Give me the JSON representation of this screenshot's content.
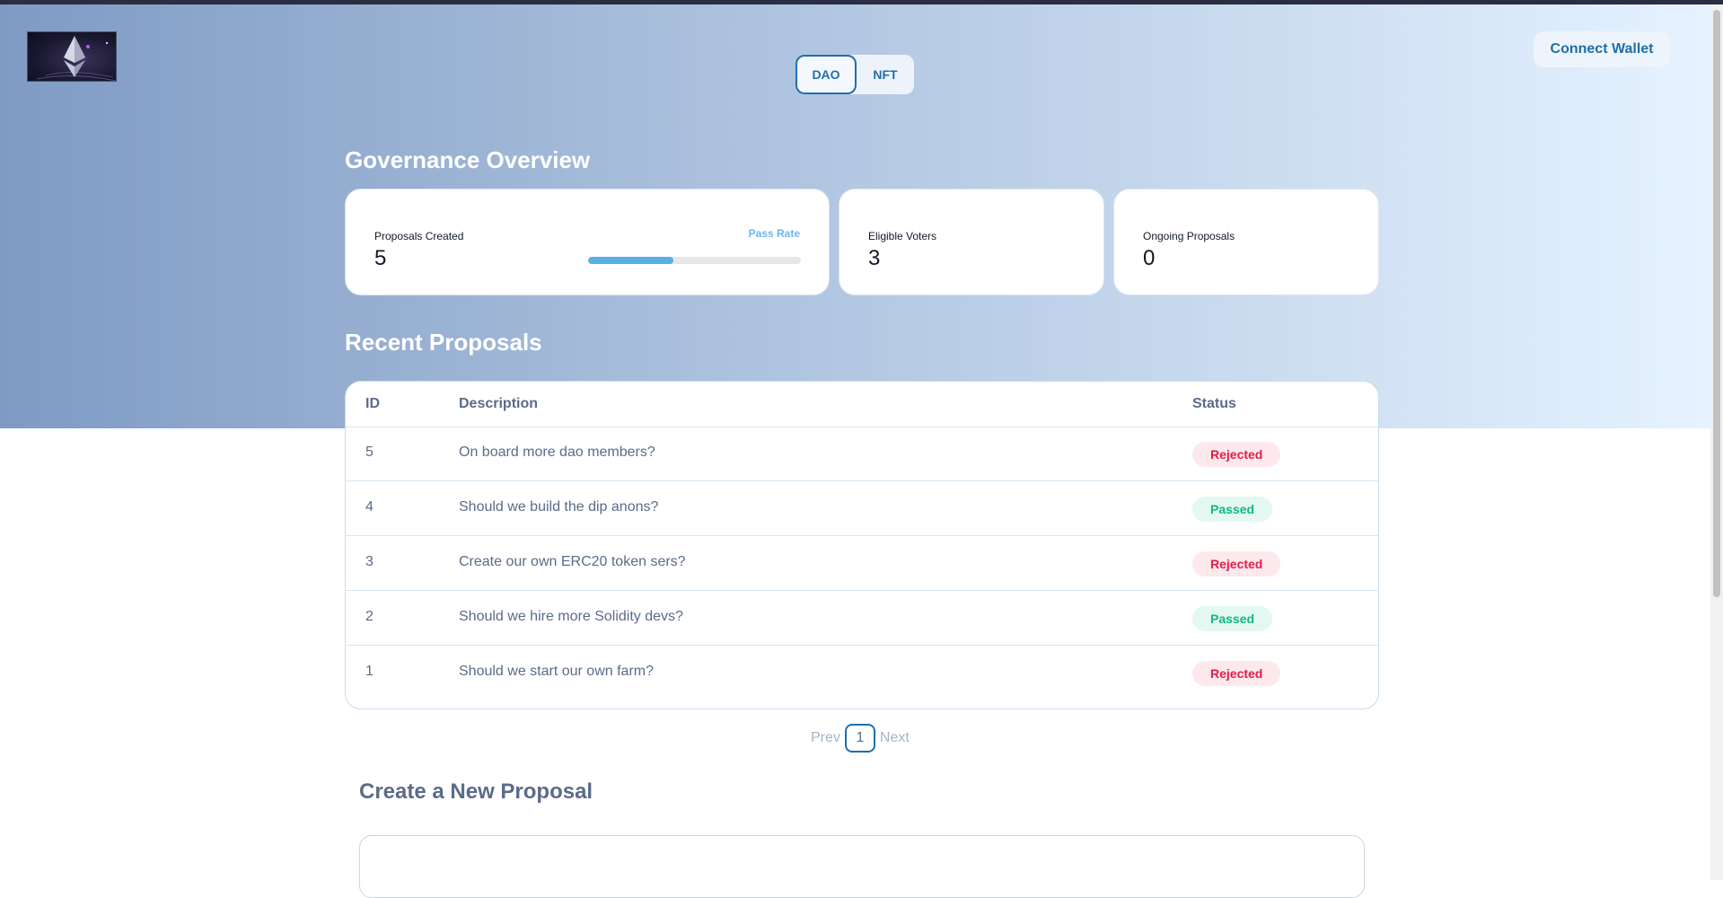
{
  "header": {
    "toggle": [
      {
        "label": "DAO",
        "active": true
      },
      {
        "label": "NFT",
        "active": false
      }
    ],
    "connect_label": "Connect Wallet",
    "logo": "ethereum-logo"
  },
  "overview": {
    "title": "Governance Overview",
    "proposals_created_label": "Proposals Created",
    "proposals_created_value": "5",
    "pass_rate_label": "Pass Rate",
    "pass_rate_fraction": 0.4,
    "eligible_voters_label": "Eligible Voters",
    "eligible_voters_value": "3",
    "ongoing_label": "Ongoing Proposals",
    "ongoing_value": "0"
  },
  "recent": {
    "title": "Recent Proposals",
    "headers": {
      "id": "ID",
      "description": "Description",
      "status": "Status"
    },
    "rows": [
      {
        "id": "5",
        "description": "On board more dao members?",
        "status": "Rejected"
      },
      {
        "id": "4",
        "description": "Should we build the dip anons?",
        "status": "Passed"
      },
      {
        "id": "3",
        "description": "Create our own ERC20 token sers?",
        "status": "Rejected"
      },
      {
        "id": "2",
        "description": "Should we hire more Solidity devs?",
        "status": "Passed"
      },
      {
        "id": "1",
        "description": "Should we start our own farm?",
        "status": "Rejected"
      }
    ]
  },
  "pagination": {
    "prev": "Prev",
    "current": "1",
    "next": "Next"
  },
  "create": {
    "title": "Create a New Proposal"
  },
  "colors": {
    "accent": "#1f6fa8",
    "passed": "#10b981",
    "rejected": "#e11d48",
    "progress": "#5aaee6"
  }
}
